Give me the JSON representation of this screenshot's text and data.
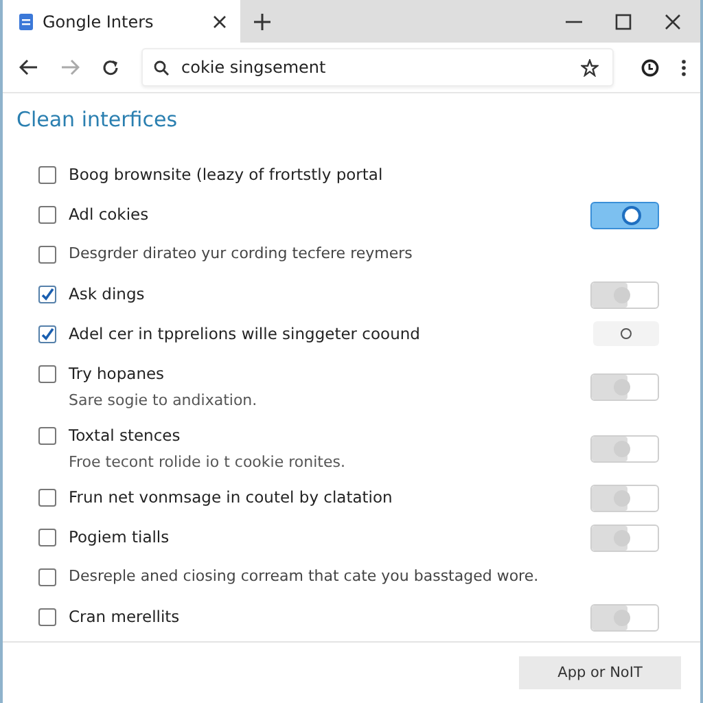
{
  "tab": {
    "title": "Gongle Inters"
  },
  "address_bar": {
    "value": "cokie singsement"
  },
  "heading": "Clean interfices",
  "rows": [
    {
      "label": "Boog brownsite (leazy of frortstly portal",
      "checked": false,
      "kind": "plain"
    },
    {
      "label": "Adl cokies",
      "checked": false,
      "kind": "switch",
      "on": true
    },
    {
      "label": "Desgrder dirateo yur cording tecfere reymers",
      "checked": false,
      "kind": "plain"
    },
    {
      "label": "Ask dings",
      "checked": true,
      "kind": "switch",
      "on": false
    },
    {
      "label": "Adel cer in tpprelions wille singgeter coound",
      "checked": true,
      "kind": "circle",
      "on": false
    },
    {
      "label": "Try hopanes",
      "sub": "Sare sogie to andixation.",
      "checked": false,
      "kind": "switch",
      "on": false
    },
    {
      "label": "Toxtal stences",
      "sub": "Froe tecont rolide io t cookie ronites.",
      "checked": false,
      "kind": "switch",
      "on": false
    },
    {
      "label": "Frun net vonmsage in coutel by clatation",
      "checked": false,
      "kind": "switch",
      "on": false
    },
    {
      "label": "Pogiem tialls",
      "checked": false,
      "kind": "switch",
      "on": false
    },
    {
      "label": "Desreple aned ciosing corream that cate you basstaged wore.",
      "checked": false,
      "kind": "plain"
    },
    {
      "label": "Cran merellits",
      "checked": false,
      "kind": "switch",
      "on": false
    }
  ],
  "footer_button": "App or NoIT"
}
